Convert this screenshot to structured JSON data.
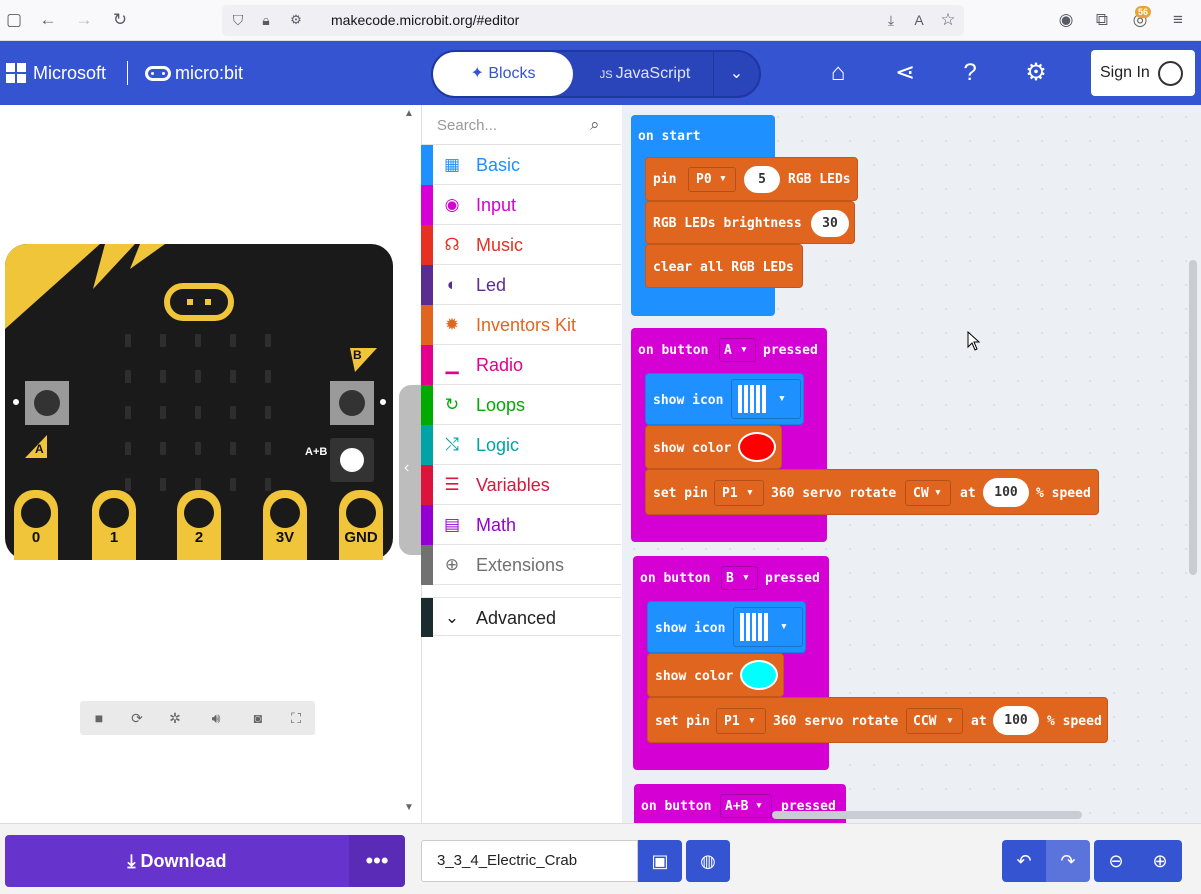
{
  "browser": {
    "url": "makecode.microbit.org/#editor",
    "badge_count": "56"
  },
  "header": {
    "brand": "Microsoft",
    "product": "micro:bit",
    "tab_blocks": "Blocks",
    "tab_javascript": "JavaScript",
    "signin": "Sign In"
  },
  "simulator": {
    "pins": [
      "0",
      "1",
      "2",
      "3V",
      "GND"
    ],
    "button_a": "A",
    "button_b": "B",
    "button_ab": "A+B"
  },
  "toolbox": {
    "search_placeholder": "Search...",
    "categories": [
      {
        "label": "Basic",
        "color": "#1e90ff",
        "icon": "grid-icon"
      },
      {
        "label": "Input",
        "color": "#d400d4",
        "icon": "target-icon"
      },
      {
        "label": "Music",
        "color": "#e63022",
        "icon": "headphones-icon"
      },
      {
        "label": "Led",
        "color": "#5c2d91",
        "icon": "toggle-icon"
      },
      {
        "label": "Inventors Kit",
        "color": "#e0661f",
        "icon": "gear-icon"
      },
      {
        "label": "Radio",
        "color": "#e3008c",
        "icon": "signal-icon"
      },
      {
        "label": "Loops",
        "color": "#00aa00",
        "icon": "refresh-icon"
      },
      {
        "label": "Logic",
        "color": "#00a4a6",
        "icon": "shuffle-icon"
      },
      {
        "label": "Variables",
        "color": "#dc143c",
        "icon": "lines-icon"
      },
      {
        "label": "Math",
        "color": "#9400d3",
        "icon": "calculator-icon"
      },
      {
        "label": "Extensions",
        "color": "#717171",
        "icon": "plus-icon"
      }
    ],
    "advanced": "Advanced"
  },
  "blocks": {
    "on_start": "on start",
    "pin": "pin",
    "pin_p0": "P0",
    "count_5": "5",
    "rgb_leds": "RGB LEDs",
    "brightness_label": "RGB LEDs brightness",
    "brightness_value": "30",
    "clear_all": "clear all RGB LEDs",
    "on_button": "on button",
    "pressed": "pressed",
    "button_a": "A",
    "button_b": "B",
    "button_ab": "A+B",
    "show_icon": "show icon",
    "show_color": "show color",
    "set_pin": "set pin",
    "pin_p1": "P1",
    "servo_rotate": "360 servo rotate",
    "dir_cw": "CW",
    "dir_ccw": "CCW",
    "at": "at",
    "speed_value": "100",
    "pct_speed": "% speed",
    "color_red": "#ff0000",
    "color_cyan": "#00ffff"
  },
  "footer": {
    "download": "Download",
    "project_name": "3_3_4_Electric_Crab"
  }
}
